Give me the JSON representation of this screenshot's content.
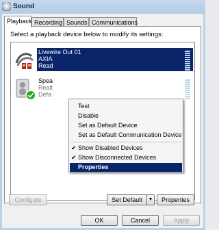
{
  "window": {
    "title": "Sound"
  },
  "tabs": [
    "Playback",
    "Recording",
    "Sounds",
    "Communications"
  ],
  "instruction": "Select a playback device below to modify its settings:",
  "devices": [
    {
      "lines": [
        "Livewire Out 01",
        "AXIA",
        "Read"
      ],
      "selected": true,
      "icon": "speaker-cable-icon"
    },
    {
      "lines": [
        "Spea",
        "Realt",
        "Defa"
      ],
      "selected": false,
      "icon": "speaker-icon",
      "badge": "default-check-icon"
    }
  ],
  "context_menu": {
    "items": [
      {
        "label": "Test",
        "checked": false
      },
      {
        "label": "Disable",
        "checked": false
      },
      {
        "label": "Set as Default Device",
        "checked": false
      },
      {
        "label": "Set as Default Communication Device",
        "checked": false
      },
      {
        "label": "Show Disabled Devices",
        "checked": true
      },
      {
        "label": "Show Disconnected Devices",
        "checked": true
      },
      {
        "label": "Properties",
        "checked": false,
        "highlighted": true
      }
    ]
  },
  "buttons": {
    "configure": "Configure",
    "set_default": "Set Default",
    "properties": "Properties",
    "ok": "OK",
    "cancel": "Cancel",
    "apply": "Apply"
  },
  "colors": {
    "selection": "#0a246a",
    "check": "#22aa22"
  }
}
